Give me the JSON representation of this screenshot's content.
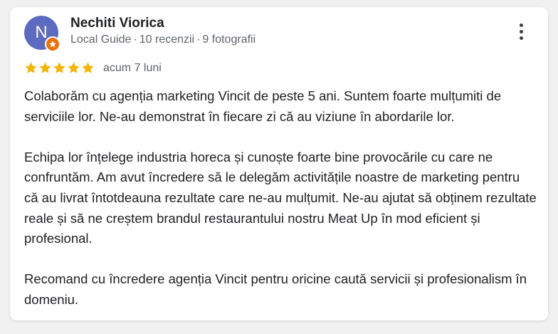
{
  "review": {
    "avatar_letter": "N",
    "avatar_color": "#5c6bc0",
    "badge_icon": "local-guide-star-badge",
    "badge_color": "#e8710a",
    "author_name": "Nechiti Viorica",
    "author_level": "Local Guide",
    "reviews_count": "10 recenzii",
    "photos_count": "9 fotografii",
    "separator": "·",
    "rating": 5,
    "rating_max": 5,
    "star_color": "#f4b400",
    "date": "acum 7 luni",
    "more_icon": "more-vertical-icon",
    "paragraphs": [
      "Colaborăm cu agenția marketing Vincit de peste 5 ani. Suntem foarte mulțumiti de serviciile lor. Ne-au demonstrat în fiecare zi că au viziune în abordarile lor.",
      "Echipa lor înțelege industria horeca și cunoște foarte bine provocările cu care ne confruntăm. Am avut încredere să le delegăm activitățile noastre de marketing pentru că au livrat întotdeauna rezultate care ne-au mulțumit. Ne-au ajutat să obținem rezultate reale și să ne creștem brandul restaurantului nostru Meat Up în mod eficient și profesional.",
      "Recomand cu încredere agenția Vincit pentru oricine caută servicii și profesionalism în domeniu."
    ]
  }
}
